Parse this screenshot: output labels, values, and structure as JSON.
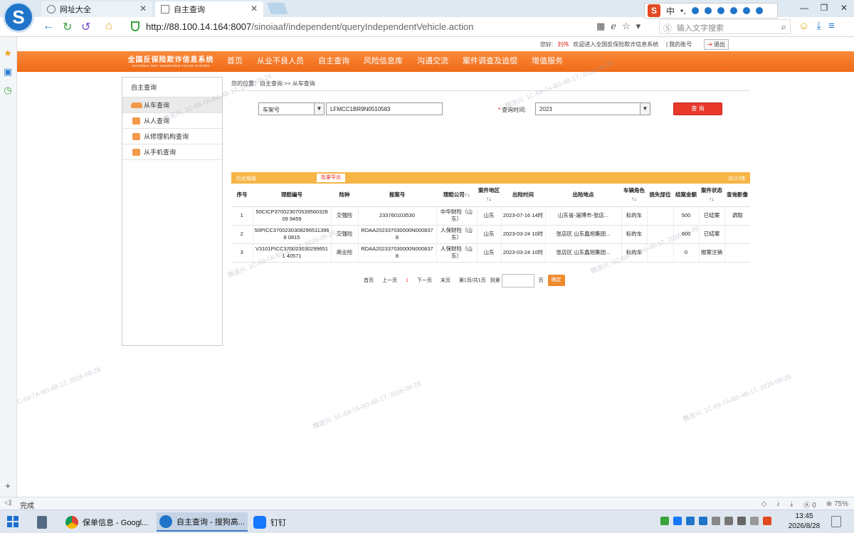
{
  "browser": {
    "tabs": [
      {
        "label": "网址大全"
      },
      {
        "label": "自主查询"
      }
    ],
    "url_host": "http://88.100.14.164:8007",
    "url_path": "/sinoiaaf/independent/queryIndependentVehicle.action",
    "search_placeholder": "输入文字搜索",
    "ime_label": "中",
    "status_text": "完成",
    "status_count": "0",
    "zoom": "75%"
  },
  "taskbar": {
    "items": [
      {
        "label": "保单信息 - Googl..."
      },
      {
        "label": "自主查询 - 搜狗高..."
      },
      {
        "label": "钉钉"
      }
    ],
    "time": "13:45",
    "date": "2026/8/28"
  },
  "header": {
    "greeting_prefix": "您好:",
    "username": "刘伟",
    "greeting_suffix": "欢迎进入全国反保险欺诈信息系统",
    "account": "| 我的账号",
    "logout": "退出",
    "brand_cn": "全国反保险欺诈信息系统",
    "brand_en": "NATIONAL ANTI INSURANCE FRAUD SYSTEM",
    "menu": [
      "首页",
      "从业不良人员",
      "自主查询",
      "风险信息库",
      "沟通交流",
      "案件调查及追偿",
      "增值服务"
    ]
  },
  "left_panel": {
    "title": "自主查询",
    "items": [
      "从车查询",
      "从人查询",
      "从修理机构查询",
      "从手机查询"
    ]
  },
  "query": {
    "breadcrumb": "您的位置：自主查询 >> 从车查询",
    "field_type": "车架号",
    "field_value": "LFMCC1BR9N0510583",
    "time_label": "查询时间:",
    "time_value": "2023",
    "submit": "查 询"
  },
  "results": {
    "title": "历史赔案",
    "export": "批量导出",
    "total": "共计3条",
    "columns": [
      "序号",
      "理赔编号",
      "险种",
      "报案号",
      "理赔公司↑↓",
      "案件地区↑↓",
      "出险时间",
      "出险地点",
      "车辆角色↑↓",
      "损失部位",
      "结案金额",
      "案件状态↑↓",
      "查询影像"
    ],
    "rows": [
      [
        "1",
        "50CICP37002307053956032809 9459",
        "交强险",
        "233760103530",
        "中华财险（山东）",
        "山东",
        "2023-07-16 14时",
        "山东省-淄博市-张店...",
        "标的车",
        "",
        "500",
        "已结案",
        "调取"
      ],
      [
        "2",
        "50PICC37002303082965113968 0815",
        "交强险",
        "RDAA202337030000N0008378",
        "人保财险（山东）",
        "山东",
        "2023-03-24 10时",
        "张店区 山东鑫旭集团...",
        "标的车",
        "",
        "600",
        "已结案",
        ""
      ],
      [
        "3",
        "V3101PICC3700230302996511 40571",
        "商业险",
        "RDAA202337030000N0008378",
        "人保财险（山东）",
        "山东",
        "2023-03-24 10时",
        "张店区 山东鑫旭集团...",
        "标的车",
        "",
        "0",
        "报案注销",
        ""
      ]
    ]
  },
  "pager": {
    "first": "首页",
    "prev": "上一页",
    "current": "1",
    "next": "下一页",
    "last": "末页",
    "info": "第1页/共1页",
    "goto": "到第",
    "page_unit": "页",
    "confirm": "确定"
  },
  "watermark": "魏连兴, 1C-69-7A-B0-4B-17, 2026-08-28",
  "colors": {
    "nav_orange": "#f06a17",
    "result_bar": "#f6b545",
    "query_button": "#e8382a"
  }
}
